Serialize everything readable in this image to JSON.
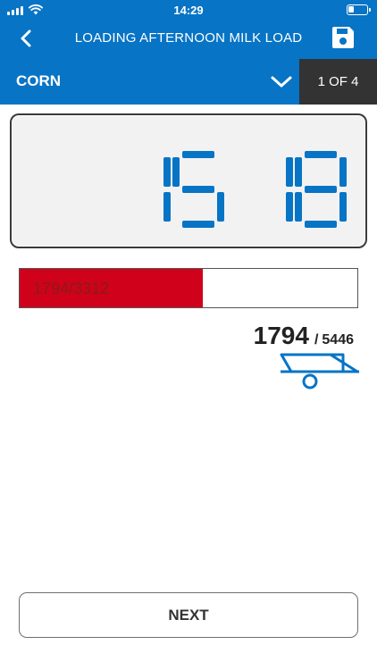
{
  "status_bar": {
    "time": "14:29"
  },
  "nav": {
    "title": "LOADING AFTERNOON MILK LOAD"
  },
  "product": {
    "name": "CORN",
    "counter": "1 OF 4"
  },
  "display": {
    "reading": "1518"
  },
  "progress": {
    "current": 1794,
    "target": 3312,
    "label": "1794/3312"
  },
  "totals": {
    "current": "1794",
    "separator": "/",
    "max": "5446"
  },
  "actions": {
    "next_label": "NEXT"
  },
  "colors": {
    "brand_blue": "#0774c5",
    "progress_red": "#d0021b",
    "counter_bg": "#333333"
  },
  "icons": {
    "back": "chevron-left-icon",
    "save": "floppy-disk-icon",
    "dropdown": "chevron-down-icon",
    "trailer": "trailer-icon"
  }
}
